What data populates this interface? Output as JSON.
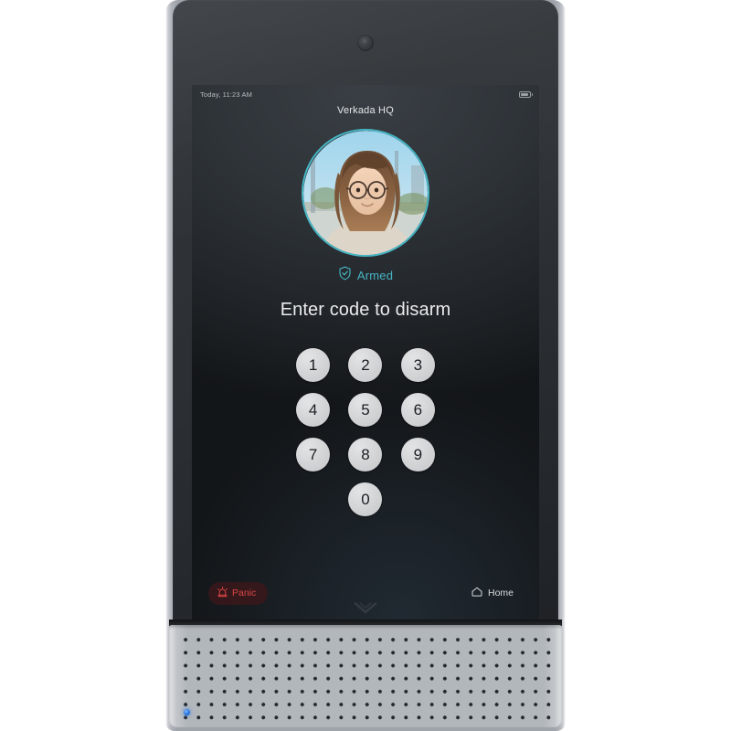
{
  "device": {
    "name": "verkada-intercom-panel",
    "camera_icon": "camera-lens-icon",
    "brand_logo_icon": "verkada-chevron-logo",
    "led_indicator": "status-led-blue",
    "chassis_color": "#9fa4aa",
    "faceplate_color": "#2b2f33"
  },
  "screen": {
    "status_bar": {
      "time": "Today, 11:23 AM",
      "battery_icon": "battery-icon"
    },
    "site_title": "Verkada HQ",
    "avatar": {
      "name": "user-avatar",
      "ring_color": "#46b5c4"
    },
    "armed": {
      "icon": "shield-check-icon",
      "label": "Armed",
      "color": "#46b5c4"
    },
    "prompt": "Enter code to disarm",
    "keypad": {
      "keys": [
        "1",
        "2",
        "3",
        "4",
        "5",
        "6",
        "7",
        "8",
        "9",
        "0"
      ],
      "key_color": "#d2d3d5",
      "key_text_color": "#1b1d20"
    },
    "bottom_bar": {
      "panic": {
        "icon": "alarm-siren-icon",
        "label": "Panic",
        "color": "#e04646"
      },
      "home": {
        "icon": "home-icon",
        "label": "Home",
        "color": "#d9dcde"
      }
    },
    "background_color": "#22262a"
  }
}
